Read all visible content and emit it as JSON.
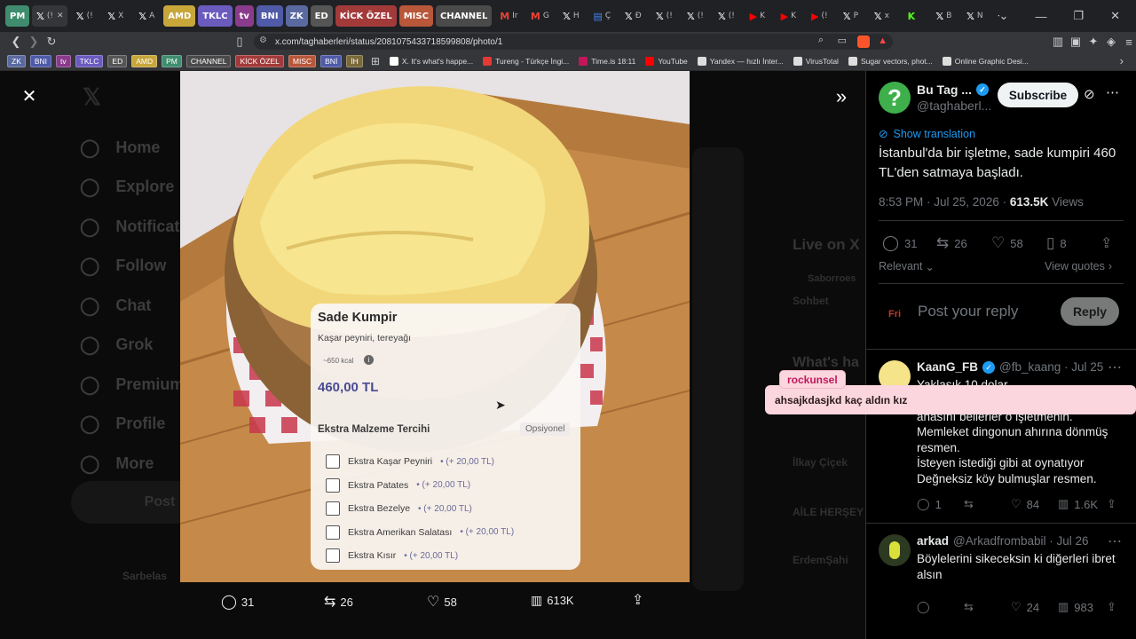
{
  "browser": {
    "tabs": [
      {
        "label": "PM",
        "bg": "#3f8d6e",
        "kind": "pill"
      },
      {
        "label": "(!",
        "kind": "active"
      },
      {
        "label": "(!",
        "kind": "x"
      },
      {
        "label": "X",
        "kind": "x"
      },
      {
        "label": "A",
        "kind": "x"
      },
      {
        "label": "AMD",
        "bg": "#c8a63a",
        "kind": "pill"
      },
      {
        "label": "TKLC",
        "bg": "#6b5bbf",
        "kind": "pill"
      },
      {
        "label": "tv",
        "bg": "#8a3b8c",
        "kind": "pill"
      },
      {
        "label": "BNI",
        "bg": "#4f5aa8",
        "kind": "pill"
      },
      {
        "label": "ZK",
        "bg": "#5a6aa0",
        "kind": "pill"
      },
      {
        "label": "ED",
        "bg": "#555",
        "kind": "pill"
      },
      {
        "label": "KİCK ÖZEL",
        "bg": "#a33a3a",
        "kind": "pill"
      },
      {
        "label": "MISC",
        "bg": "#b8573a",
        "kind": "pill"
      },
      {
        "label": "CHANNEL",
        "bg": "#4a4a4a",
        "kind": "pill"
      },
      {
        "label": "Ir",
        "kind": "gmail"
      },
      {
        "label": "G",
        "kind": "gmail"
      },
      {
        "label": "H",
        "kind": "x"
      },
      {
        "label": "Ç",
        "kind": "doc"
      },
      {
        "label": "Đ",
        "kind": "x"
      },
      {
        "label": "(!",
        "kind": "x"
      },
      {
        "label": "(!",
        "kind": "x"
      },
      {
        "label": "(!",
        "kind": "x"
      },
      {
        "label": "K",
        "kind": "yt"
      },
      {
        "label": "K",
        "kind": "yt"
      },
      {
        "label": "(!",
        "kind": "yt"
      },
      {
        "label": "P",
        "kind": "x"
      },
      {
        "label": "x",
        "kind": "x"
      },
      {
        "label": "",
        "kind": "kick"
      },
      {
        "label": "B",
        "kind": "x"
      },
      {
        "label": "N",
        "kind": "x"
      }
    ],
    "new_tab": "+",
    "url": "x.com/taghaberleri/status/2081075433718599808/photo/1",
    "bookmarks_pills": [
      {
        "label": "ZK",
        "bg": "#5a6aa0"
      },
      {
        "label": "BNI",
        "bg": "#4f5aa8"
      },
      {
        "label": "tv",
        "bg": "#8a3b8c"
      },
      {
        "label": "TKLC",
        "bg": "#6b5bbf"
      },
      {
        "label": "ED",
        "bg": "#555"
      },
      {
        "label": "AMD",
        "bg": "#c8a63a"
      },
      {
        "label": "PM",
        "bg": "#3f8d6e"
      },
      {
        "label": "CHANNEL",
        "bg": "#4a4a4a"
      },
      {
        "label": "KİCK ÖZEL",
        "bg": "#a33a3a"
      },
      {
        "label": "MISC",
        "bg": "#b8573a"
      },
      {
        "label": "BNİ",
        "bg": "#4f5aa8"
      },
      {
        "label": "İH",
        "bg": "#7a6a3a"
      }
    ],
    "bookmarks_links": [
      {
        "label": "X. It's what's happe...",
        "color": "#fff"
      },
      {
        "label": "Tureng - Türkçe İngi...",
        "color": "#e53935"
      },
      {
        "label": "Time.is 18:11",
        "color": "#c2185b"
      },
      {
        "label": "YouTube",
        "color": "#ff0000"
      },
      {
        "label": "Yandex — hızlı İnter...",
        "color": "#ddd"
      },
      {
        "label": "VirusTotal",
        "color": "#ddd"
      },
      {
        "label": "Sugar vectors, phot...",
        "color": "#ddd"
      },
      {
        "label": "Online Graphic Desi...",
        "color": "#ddd"
      }
    ]
  },
  "background_nav": [
    "Home",
    "Explore",
    "Notifications",
    "Follow",
    "Chat",
    "Grok",
    "Premium",
    "Profile",
    "More"
  ],
  "background_post_button": "Post",
  "background_side": {
    "live": "Live on X",
    "whats": "What's ha",
    "names": [
      "Saborroes",
      "Sohbet",
      "İlkay Çiçek",
      "AİLE HERŞEY",
      "ErdemŞahi"
    ],
    "profile": "Sarbelas"
  },
  "photo_menu": {
    "title": "Sade Kumpir",
    "subtitle": "Kaşar peyniri, tereyağı",
    "kcal": "~650 kcal",
    "price": "460,00 TL",
    "extras_title": "Ekstra Malzeme Tercihi",
    "optional": "Opsiyonel",
    "options": [
      {
        "name": "Ekstra Kaşar Peyniri",
        "price": "• (+ 20,00 TL)"
      },
      {
        "name": "Ekstra Patates",
        "price": "• (+ 20,00 TL)"
      },
      {
        "name": "Ekstra Bezelye",
        "price": "• (+ 20,00 TL)"
      },
      {
        "name": "Ekstra Amerikan Salatası",
        "price": "• (+ 20,00 TL)"
      },
      {
        "name": "Ekstra Kısır",
        "price": "• (+ 20,00 TL)"
      }
    ]
  },
  "photo_actions": {
    "replies": "31",
    "reposts": "26",
    "likes": "58",
    "views": "613K"
  },
  "post": {
    "author_name": "Bu Tag ...",
    "handle": "@taghaberl...",
    "subscribe": "Subscribe",
    "show_translation": "Show translation",
    "text": "İstanbul'da bir işletme, sade kumpiri 460 TL'den satmaya başladı.",
    "time": "8:53 PM · Jul 25, 2026 · ",
    "views_count": "613.5K",
    "views_label": " Views",
    "stats": {
      "replies": "31",
      "reposts": "26",
      "likes": "58",
      "bookmarks": "8"
    },
    "relevant": "Relevant",
    "view_quotes": "View quotes",
    "reply_placeholder": "Post your reply",
    "reply_button": "Reply",
    "reply_avatar": "Fri"
  },
  "replies": [
    {
      "name": "KaanG_FB",
      "handle": "@fb_kaang · Jul 25",
      "lines": [
        "Yaklaşık 10 dolar.",
        "anasını bellerler o işletmenin.",
        "Memleket dingonun ahırına dönmüş resmen.",
        "İsteyen istediği gibi at oynatıyor",
        "Değneksiz köy bulmuşlar resmen."
      ],
      "stats": {
        "replies": "1",
        "reposts": "",
        "likes": "84",
        "views": "1.6K"
      }
    },
    {
      "name": "arkad",
      "handle": "@Arkadfrombabil · Jul 26",
      "lines": [
        "Böylelerini sikeceksin ki diğerleri ibret",
        "alsın"
      ],
      "stats": {
        "replies": "",
        "reposts": "",
        "likes": "24",
        "views": "983"
      }
    }
  ],
  "overlay_chat": {
    "user": "rockunsel",
    "message": "ahsajkdasjkd kaç aldın kız"
  }
}
